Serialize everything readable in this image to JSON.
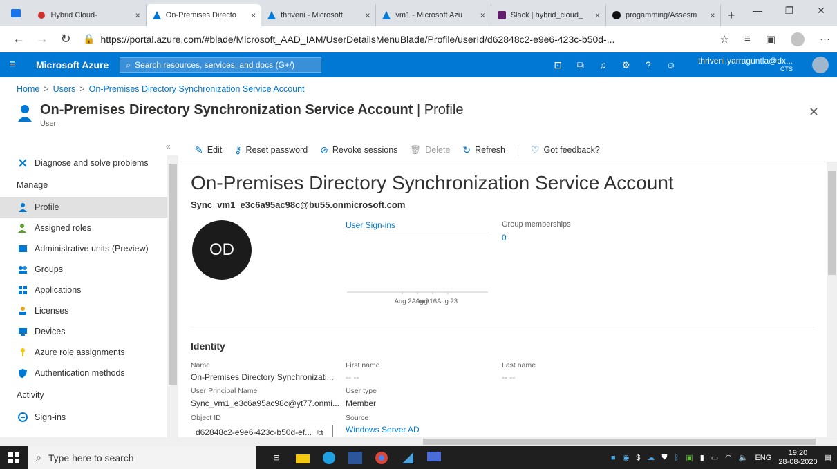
{
  "browser": {
    "tabs": [
      {
        "label": "Hybrid Cloud- ",
        "active": false
      },
      {
        "label": "On-Premises Directo",
        "active": true
      },
      {
        "label": "thriveni - Microsoft",
        "active": false
      },
      {
        "label": "vm1 - Microsoft Azu",
        "active": false
      },
      {
        "label": "Slack | hybrid_cloud_",
        "active": false
      },
      {
        "label": "progamming/Assesm",
        "active": false
      }
    ],
    "close_glyph": "×",
    "new_tab_glyph": "+",
    "url_host": "https://portal.azure.com/#blade/Microsoft_AAD_IAM/UserDetailsMenuBlade/Profile/userId/d62848c2-e9e6-423c-b50d-..."
  },
  "azure_header": {
    "brand": "Microsoft Azure",
    "search_placeholder": "Search resources, services, and docs (G+/)",
    "user_email": "thriveni.yarraguntla@dx...",
    "user_org": "CTS"
  },
  "breadcrumb": [
    "Home",
    "Users",
    "On-Premises Directory Synchronization Service Account"
  ],
  "breadcrumb_sep": ">",
  "blade": {
    "title": "On-Premises Directory Synchronization Service Account",
    "title_suffix": "| Profile",
    "subtitle": "User"
  },
  "leftnav": {
    "items": [
      {
        "label": "Diagnose and solve problems",
        "type": "item"
      },
      {
        "label": "Manage",
        "type": "header"
      },
      {
        "label": "Profile",
        "type": "item",
        "active": true
      },
      {
        "label": "Assigned roles",
        "type": "item"
      },
      {
        "label": "Administrative units (Preview)",
        "type": "item"
      },
      {
        "label": "Groups",
        "type": "item"
      },
      {
        "label": "Applications",
        "type": "item"
      },
      {
        "label": "Licenses",
        "type": "item"
      },
      {
        "label": "Devices",
        "type": "item"
      },
      {
        "label": "Azure role assignments",
        "type": "item"
      },
      {
        "label": "Authentication methods",
        "type": "item"
      },
      {
        "label": "Activity",
        "type": "header"
      },
      {
        "label": "Sign-ins",
        "type": "item"
      }
    ],
    "collapse_glyph": "«"
  },
  "toolbar": {
    "edit": "Edit",
    "reset_password": "Reset password",
    "revoke_sessions": "Revoke sessions",
    "delete": "Delete",
    "refresh": "Refresh",
    "feedback": "Got feedback?"
  },
  "profile": {
    "display_name": "On-Premises Directory Synchronization Service Account",
    "upn_head": "Sync_vm1_e3c6a95ac98c@bu55.onmicrosoft.com",
    "initials": "OD",
    "signins_title": "User Sign-ins",
    "group_label": "Group memberships",
    "group_count": "0"
  },
  "chart_data": {
    "type": "line",
    "title": "User Sign-ins",
    "categories": [
      "Aug 2",
      "Aug 9",
      "Aug 16",
      "Aug 23"
    ],
    "tick_labels": [
      "Aug 2",
      "Aug 9",
      "Aug 16Aug 23"
    ],
    "values": [
      0,
      0,
      0,
      0
    ]
  },
  "identity": {
    "heading": "Identity",
    "name_label": "Name",
    "name_value": "On-Premises Directory Synchronizati...",
    "first_name_label": "First name",
    "first_name_value": "-- --",
    "last_name_label": "Last name",
    "last_name_value": "-- --",
    "upn_label": "User Principal Name",
    "upn_value": "Sync_vm1_e3c6a95ac98c@yt77.onmi...",
    "user_type_label": "User type",
    "user_type_value": "Member",
    "object_id_label": "Object ID",
    "object_id_value": "d62848c2-e9e6-423c-b50d-ef...",
    "source_label": "Source",
    "source_value": "Windows Server AD"
  },
  "taskbar": {
    "search_placeholder": "Type here to search",
    "language": "ENG",
    "time": "19:20",
    "date": "28-08-2020"
  },
  "colors": {
    "azure_blue": "#0078d4",
    "taskbar": "#1f1f1f"
  }
}
